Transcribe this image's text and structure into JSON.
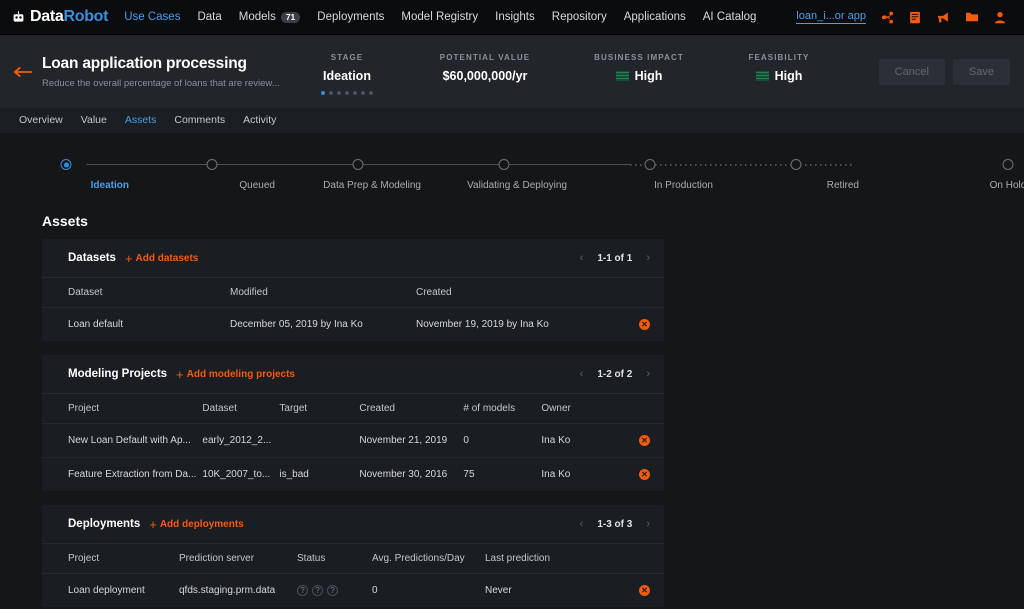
{
  "topnav": {
    "brand_white": "Data",
    "brand_blue": "Robot",
    "brand_logo_icon": "robot-icon",
    "items": [
      {
        "label": "Use Cases",
        "active": true
      },
      {
        "label": "Data",
        "active": false
      },
      {
        "label": "Models",
        "active": false,
        "badge": "71"
      },
      {
        "label": "Deployments",
        "active": false
      },
      {
        "label": "Model Registry",
        "active": false
      },
      {
        "label": "Insights",
        "active": false
      },
      {
        "label": "Repository",
        "active": false
      },
      {
        "label": "Applications",
        "active": false
      },
      {
        "label": "AI Catalog",
        "active": false
      }
    ],
    "app_link": "loan_i...or app",
    "icons": [
      "share-icon",
      "book-icon",
      "megaphone-icon",
      "folder-icon",
      "user-icon"
    ]
  },
  "header": {
    "back_icon": "back-arrow-icon",
    "title": "Loan application processing",
    "subtitle": "Reduce the overall percentage of loans that are review...",
    "metrics": [
      {
        "label": "STAGE",
        "value": "Ideation",
        "kind": "stage",
        "dots_total": 7,
        "dots_active": 1
      },
      {
        "label": "POTENTIAL VALUE",
        "value": "$60,000,000/yr",
        "kind": "plain"
      },
      {
        "label": "BUSINESS IMPACT",
        "value": "High",
        "kind": "bars"
      },
      {
        "label": "FEASIBILITY",
        "value": "High",
        "kind": "bars"
      }
    ],
    "cancel_label": "Cancel",
    "save_label": "Save"
  },
  "tabs": [
    {
      "label": "Overview",
      "active": false
    },
    {
      "label": "Value",
      "active": false
    },
    {
      "label": "Assets",
      "active": true
    },
    {
      "label": "Comments",
      "active": false
    },
    {
      "label": "Activity",
      "active": false
    }
  ],
  "stepper": {
    "steps": [
      {
        "label": "Ideation",
        "current": true
      },
      {
        "label": "Queued",
        "current": false
      },
      {
        "label": "Data Prep & Modeling",
        "current": false
      },
      {
        "label": "Validating & Deploying",
        "current": false
      },
      {
        "label": "In Production",
        "current": false
      },
      {
        "label": "Retired",
        "current": false
      },
      {
        "label": "On Hold",
        "current": false
      }
    ]
  },
  "assets": {
    "section_title": "Assets",
    "cards": [
      {
        "title": "Datasets",
        "add_label": "Add datasets",
        "page_count": "1-1 of 1",
        "columns": [
          "Dataset",
          "Modified",
          "Created"
        ],
        "rows": [
          [
            "Loan default",
            "December 05, 2019 by Ina Ko",
            "November 19, 2019 by Ina Ko"
          ]
        ]
      },
      {
        "title": "Modeling Projects",
        "add_label": "Add modeling projects",
        "page_count": "1-2 of 2",
        "columns": [
          "Project",
          "Dataset",
          "Target",
          "Created",
          "# of models",
          "Owner"
        ],
        "rows": [
          [
            "New Loan Default with Ap...",
            "early_2012_2...",
            "",
            "November 21, 2019",
            "0",
            "Ina Ko"
          ],
          [
            "Feature Extraction from Da...",
            "10K_2007_to...",
            "is_bad",
            "November 30, 2016",
            "75",
            "Ina Ko"
          ]
        ]
      },
      {
        "title": "Deployments",
        "add_label": "Add deployments",
        "page_count": "1-3 of 3",
        "columns": [
          "Project",
          "Prediction server",
          "Status",
          "Avg. Predictions/Day",
          "Last prediction"
        ],
        "rows": [
          [
            "Loan deployment",
            "qfds.staging.prm.data",
            "status-dots",
            "0",
            "Never"
          ]
        ]
      }
    ],
    "delete_icon": "delete-circle-icon",
    "prev_icon": "chevron-left-icon",
    "next_icon": "chevron-right-icon"
  },
  "colors": {
    "accent_orange": "#f55b0a",
    "accent_blue": "#4a9eea",
    "page_bg": "#141618",
    "card_bg": "#1a1d21",
    "header_bg": "#22262a",
    "nav_bg": "#0b0c0d",
    "impact_green": "#0e5135"
  }
}
